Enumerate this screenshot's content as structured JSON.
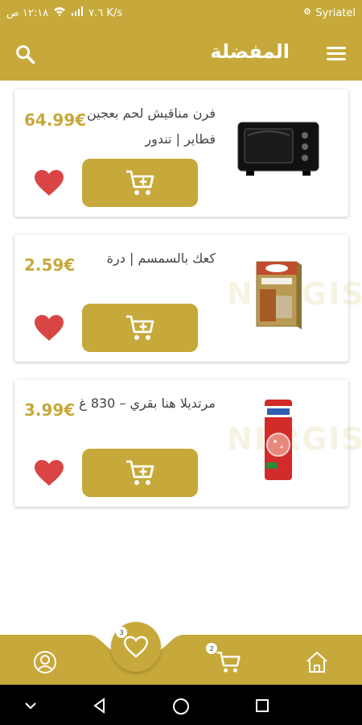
{
  "status_bar": {
    "carrier": "Syriatel",
    "speed": "٧.٦ K/s",
    "time": "١٢:١٨ ص"
  },
  "header": {
    "title": "المفضلة",
    "search_icon": "search-icon",
    "menu_icon": "menu-icon"
  },
  "products": [
    {
      "name": "فرن مناقيش لحم بعجين فطاير | تندور",
      "price": "64.99€",
      "image": "oven",
      "cart_icon": "cart-plus-icon",
      "favorite_icon": "heart-icon"
    },
    {
      "name": "كعك بالسمسم | درة",
      "price": "2.59€",
      "image": "biscuit-box",
      "cart_icon": "cart-plus-icon",
      "favorite_icon": "heart-icon",
      "watermark": "NERGIS"
    },
    {
      "name": "مرتديلا هنا بقري – 830 غ",
      "price": "3.99€",
      "image": "mortadella",
      "cart_icon": "cart-plus-icon",
      "favorite_icon": "heart-icon",
      "watermark": "NERGIS"
    }
  ],
  "bottom_nav": {
    "items": [
      {
        "name": "profile",
        "icon": "user-icon"
      },
      {
        "name": "favorites",
        "icon": "heart-icon",
        "badge": "3"
      },
      {
        "name": "cart",
        "icon": "cart-icon",
        "badge": "2"
      },
      {
        "name": "home",
        "icon": "home-icon"
      }
    ]
  },
  "android_nav": {
    "buttons": [
      "back-icon",
      "home-circle-icon",
      "recent-apps-icon",
      "chevron-down-icon"
    ]
  },
  "colors": {
    "accent": "#c6a93a",
    "heart": "#d94545",
    "text": "#444444",
    "background": "#ffffff"
  }
}
